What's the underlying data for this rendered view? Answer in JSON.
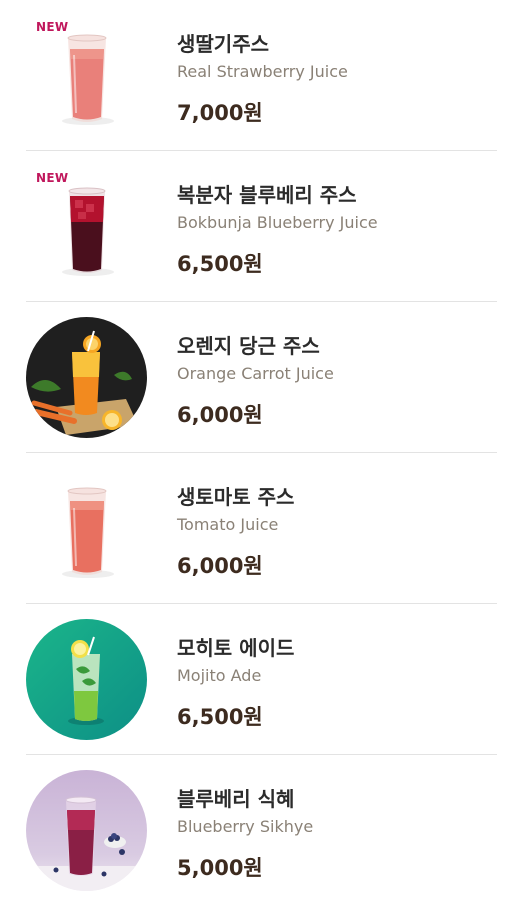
{
  "items": [
    {
      "badge": "NEW",
      "name_ko": "생딸기주스",
      "name_en": "Real Strawberry Juice",
      "price": "7,000원"
    },
    {
      "badge": "NEW",
      "name_ko": "복분자 블루베리 주스",
      "name_en": "Bokbunja Blueberry Juice",
      "price": "6,500원"
    },
    {
      "badge": "",
      "name_ko": "오렌지 당근 주스",
      "name_en": "Orange Carrot Juice",
      "price": "6,000원"
    },
    {
      "badge": "",
      "name_ko": "생토마토 주스",
      "name_en": "Tomato Juice",
      "price": "6,000원"
    },
    {
      "badge": "",
      "name_ko": "모히토 에이드",
      "name_en": "Mojito Ade",
      "price": "6,500원"
    },
    {
      "badge": "",
      "name_ko": "블루베리 식혜",
      "name_en": "Blueberry Sikhye",
      "price": "5,000원"
    }
  ],
  "colors": {
    "badge": "#c0175c",
    "price": "#3d2b1f",
    "english_name": "#8a8176"
  }
}
